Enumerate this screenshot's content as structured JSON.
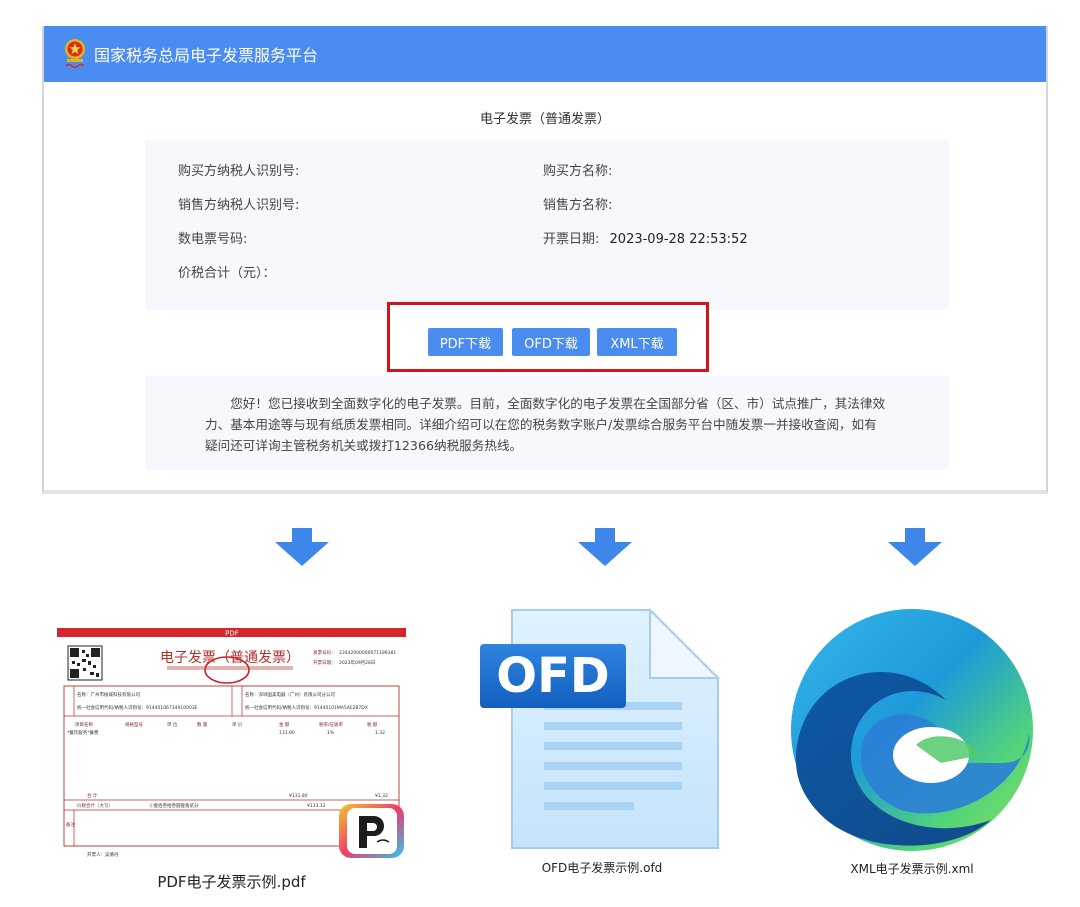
{
  "header": {
    "title": "国家税务总局电子发票服务平台"
  },
  "invoice": {
    "type_title": "电子发票（普通发票）",
    "buyer_tax_id_label": "购买方纳税人识别号:",
    "buyer_name_label": "购买方名称:",
    "seller_tax_id_label": "销售方纳税人识别号:",
    "seller_name_label": "销售方名称:",
    "invoice_number_label": "数电票号码:",
    "issue_date_label": "开票日期:",
    "issue_date_value": "2023-09-28 22:53:52",
    "total_label": "价税合计（元）："
  },
  "downloads": {
    "pdf_label": "PDF下载",
    "ofd_label": "OFD下载",
    "xml_label": "XML下载"
  },
  "notice": {
    "text": "您好！您已接收到全面数字化的电子发票。目前，全面数字化的电子发票在全国部分省（区、市）试点推广，其法律效力、基本用途等与现有纸质发票相同。详细介绍可以在您的税务数字账户/发票综合服务平台中随发票一并接收查阅，如有疑问还可详询主管税务机关或拨打12366纳税服务热线。"
  },
  "files": {
    "pdf_caption": "PDF电子发票示例.pdf",
    "ofd_caption": "OFD电子发票示例.ofd",
    "xml_caption": "XML电子发票示例.xml",
    "ofd_icon_text": "OFD"
  },
  "pdf_preview": {
    "banner": "PDF",
    "title": "电子发票（普通发票）",
    "number_label": "发票号码：",
    "number": "23442000000071189381",
    "date_label": "开票日期：",
    "date": "2023年09月28日",
    "buyer_name": "名称：广州市俪城科技有限公司",
    "buyer_tax_id": "统一社会信用代码/纳税人识别号：91440106734910003E",
    "seller_name": "名称：深圳国美电器（广州）有限公司分公司",
    "seller_tax_id": "统一社会信用代码/纳税人识别号：91440101MA5AE287DX",
    "col_item": "项目名称",
    "col_spec": "规格型号",
    "col_unit": "单 位",
    "col_qty": "数 量",
    "col_price": "单 价",
    "col_amount": "金 额",
    "col_rate": "税率/征收率",
    "col_tax": "税 额",
    "item_name": "*餐饮服务*餐费",
    "item_amount": "131.80",
    "item_rate": "1%",
    "item_tax": "1.32",
    "sum_label": "合 计",
    "sum_amount": "¥131.80",
    "sum_tax": "¥1.32",
    "total_label": "价税合计（大写）",
    "total_words": "ⓧ壹佰叁拾叁圆壹角贰分",
    "total_num": "¥133.12",
    "remark_label": "备注",
    "issuer": "开票人：吴倩丹"
  },
  "colors": {
    "accent": "#4b8cf0",
    "highlight_border": "#d2151a",
    "panel_bg": "#f6f8fd"
  }
}
